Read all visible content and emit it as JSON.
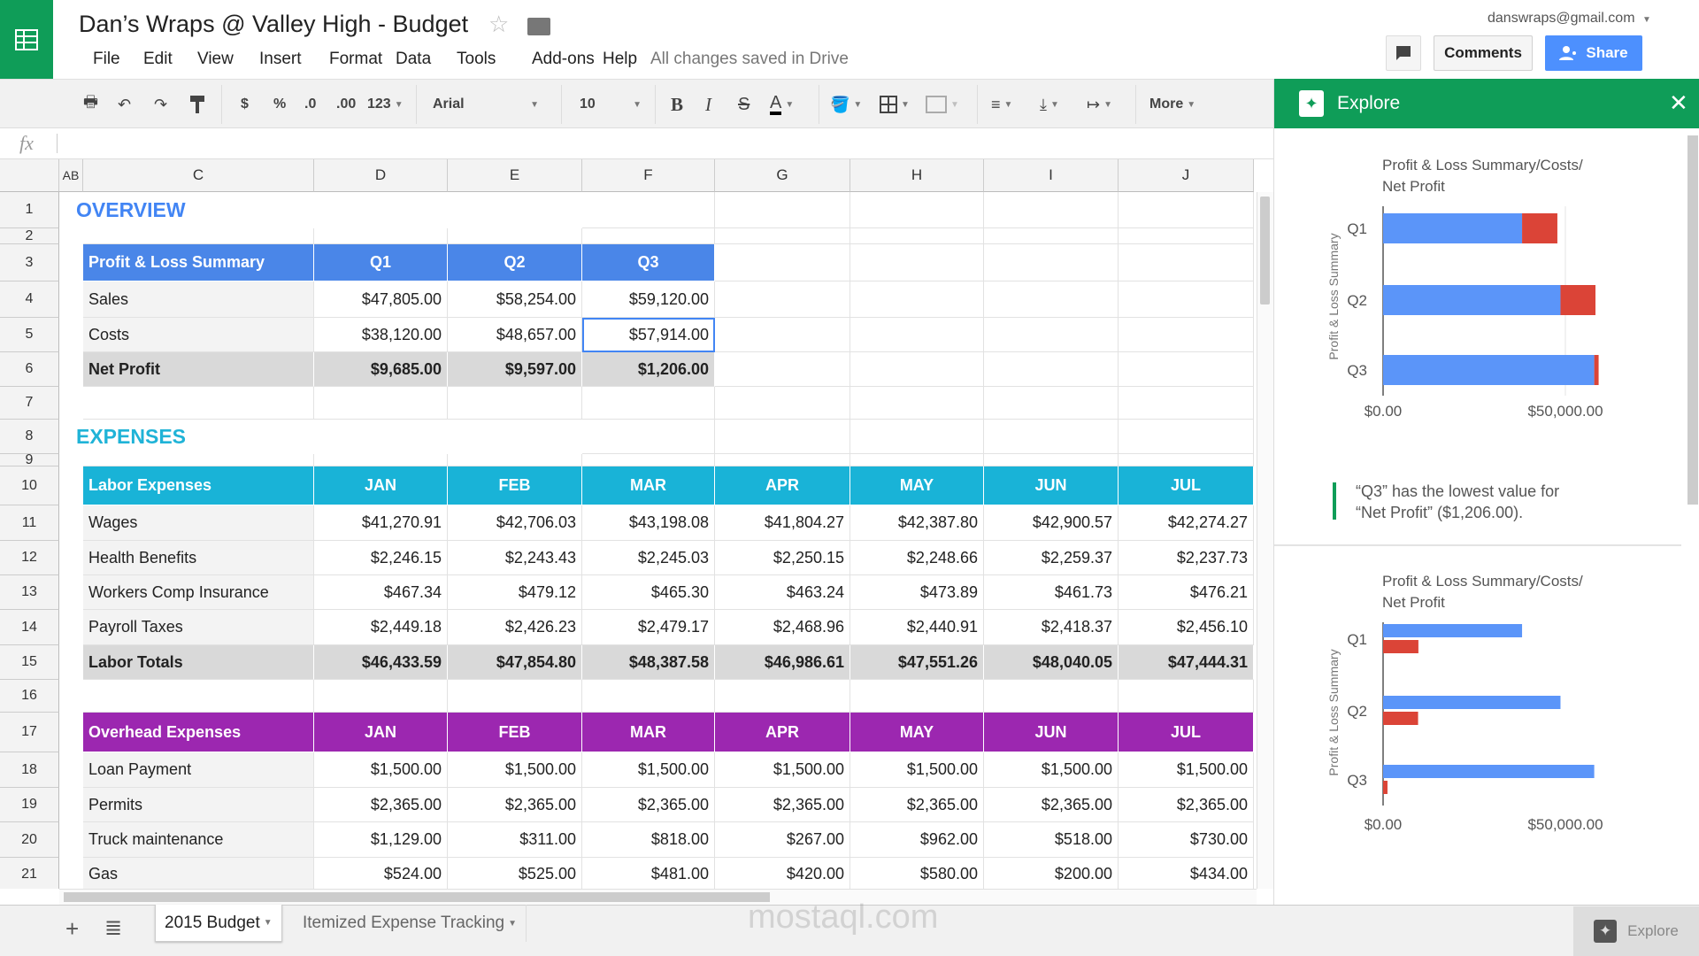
{
  "doc": {
    "title": "Dan’s Wraps @ Valley High - Budget",
    "saved_status": "All changes saved in Drive",
    "account": "danswraps@gmail.com"
  },
  "menu": [
    "File",
    "Edit",
    "View",
    "Insert",
    "Format",
    "Data",
    "Tools",
    "Add-ons",
    "Help"
  ],
  "buttons": {
    "comments": "Comments",
    "share": "Share"
  },
  "toolbar": {
    "currency": "$",
    "percent": "%",
    "dec_less": ".0",
    "dec_more": ".00",
    "format_more": "123",
    "font": "Arial",
    "size": "10",
    "bold": "B",
    "italic": "I",
    "strike": "S",
    "text_color": "A",
    "more": "More"
  },
  "formula": {
    "label": "fx",
    "value": ""
  },
  "sheet": {
    "columns": [
      "A",
      "B",
      "C",
      "D",
      "E",
      "F",
      "G",
      "H",
      "I",
      "J"
    ],
    "ab_label": "AB",
    "colors": {
      "overview": "#4285f4",
      "expenses": "#1fb3d7",
      "pl_header": "#4a86e8",
      "labor_header": "#19b3d7",
      "overhead_header": "#9c27b0",
      "selection": "#4285f4"
    },
    "rows": [
      {
        "n": "1",
        "kind": "section",
        "title": "OVERVIEW",
        "color": "overview"
      },
      {
        "n": "2",
        "kind": "empty"
      },
      {
        "n": "3",
        "kind": "header",
        "color": "pl_header",
        "cells": [
          "Profit & Loss Summary",
          "Q1",
          "Q2",
          "Q3"
        ]
      },
      {
        "n": "4",
        "kind": "data",
        "cells": [
          "Sales",
          "$47,805.00",
          "$58,254.00",
          "$59,120.00"
        ]
      },
      {
        "n": "5",
        "kind": "data",
        "cells": [
          "Costs",
          "$38,120.00",
          "$48,657.00",
          "$57,914.00"
        ],
        "selected": 3
      },
      {
        "n": "6",
        "kind": "total",
        "cells": [
          "Net Profit",
          "$9,685.00",
          "$9,597.00",
          "$1,206.00"
        ]
      },
      {
        "n": "7",
        "kind": "empty"
      },
      {
        "n": "8",
        "kind": "section",
        "title": "EXPENSES",
        "color": "expenses"
      },
      {
        "n": "9",
        "kind": "empty"
      },
      {
        "n": "10",
        "kind": "header",
        "color": "labor_header",
        "cells": [
          "Labor Expenses",
          "JAN",
          "FEB",
          "MAR",
          "APR",
          "MAY",
          "JUN",
          "JUL"
        ]
      },
      {
        "n": "11",
        "kind": "data",
        "cells": [
          "Wages",
          "$41,270.91",
          "$42,706.03",
          "$43,198.08",
          "$41,804.27",
          "$42,387.80",
          "$42,900.57",
          "$42,274.27"
        ]
      },
      {
        "n": "12",
        "kind": "data",
        "cells": [
          "Health Benefits",
          "$2,246.15",
          "$2,243.43",
          "$2,245.03",
          "$2,250.15",
          "$2,248.66",
          "$2,259.37",
          "$2,237.73"
        ]
      },
      {
        "n": "13",
        "kind": "data",
        "cells": [
          "Workers Comp Insurance",
          "$467.34",
          "$479.12",
          "$465.30",
          "$463.24",
          "$473.89",
          "$461.73",
          "$476.21"
        ]
      },
      {
        "n": "14",
        "kind": "data",
        "cells": [
          "Payroll Taxes",
          "$2,449.18",
          "$2,426.23",
          "$2,479.17",
          "$2,468.96",
          "$2,440.91",
          "$2,418.37",
          "$2,456.10"
        ]
      },
      {
        "n": "15",
        "kind": "total",
        "cells": [
          "Labor Totals",
          "$46,433.59",
          "$47,854.80",
          "$48,387.58",
          "$46,986.61",
          "$47,551.26",
          "$48,040.05",
          "$47,444.31"
        ]
      },
      {
        "n": "16",
        "kind": "empty"
      },
      {
        "n": "17",
        "kind": "header",
        "color": "overhead_header",
        "cells": [
          "Overhead Expenses",
          "JAN",
          "FEB",
          "MAR",
          "APR",
          "MAY",
          "JUN",
          "JUL"
        ]
      },
      {
        "n": "18",
        "kind": "data",
        "cells": [
          "Loan Payment",
          "$1,500.00",
          "$1,500.00",
          "$1,500.00",
          "$1,500.00",
          "$1,500.00",
          "$1,500.00",
          "$1,500.00"
        ]
      },
      {
        "n": "19",
        "kind": "data",
        "cells": [
          "Permits",
          "$2,365.00",
          "$2,365.00",
          "$2,365.00",
          "$2,365.00",
          "$2,365.00",
          "$2,365.00",
          "$2,365.00"
        ]
      },
      {
        "n": "20",
        "kind": "data",
        "cells": [
          "Truck maintenance",
          "$1,129.00",
          "$311.00",
          "$818.00",
          "$267.00",
          "$962.00",
          "$518.00",
          "$730.00"
        ]
      },
      {
        "n": "21",
        "kind": "data",
        "cells": [
          "Gas",
          "$524.00",
          "$525.00",
          "$481.00",
          "$420.00",
          "$580.00",
          "$200.00",
          "$434.00"
        ]
      }
    ]
  },
  "sheet_tabs": [
    "2015 Budget",
    "Itemized Expense Tracking"
  ],
  "explore": {
    "title": "Explore",
    "insight": [
      "“Q3” has the lowest value for",
      "“Net Profit” ($1,206.00)."
    ],
    "button_label": "Explore"
  },
  "watermark": "mostaql.com",
  "chart_data": [
    {
      "type": "bar",
      "orientation": "horizontal",
      "stacked": true,
      "title": [
        "Profit & Loss Summary/Costs/",
        "Net Profit"
      ],
      "ylabel": "Profit & Loss Summary",
      "categories": [
        "Q1",
        "Q2",
        "Q3"
      ],
      "series": [
        {
          "name": "Costs",
          "color": "#5b95f9",
          "values": [
            38120,
            48657,
            57914
          ]
        },
        {
          "name": "Net Profit",
          "color": "#db4437",
          "values": [
            9685,
            9597,
            1206
          ]
        }
      ],
      "xticks": [
        "$0.00",
        "$50,000.00"
      ],
      "xtick_values": [
        0,
        50000
      ],
      "grid": true
    },
    {
      "type": "bar",
      "orientation": "horizontal",
      "stacked": false,
      "title": [
        "Profit & Loss Summary/Costs/",
        "Net Profit"
      ],
      "ylabel": "Profit & Loss Summary",
      "categories": [
        "Q1",
        "Q2",
        "Q3"
      ],
      "series": [
        {
          "name": "Costs",
          "color": "#5b95f9",
          "values": [
            38120,
            48657,
            57914
          ]
        },
        {
          "name": "Net Profit",
          "color": "#db4437",
          "values": [
            9685,
            9597,
            1206
          ]
        }
      ],
      "xticks": [
        "$0.00",
        "$50,000.00"
      ],
      "xtick_values": [
        0,
        50000
      ],
      "grid": false
    }
  ]
}
